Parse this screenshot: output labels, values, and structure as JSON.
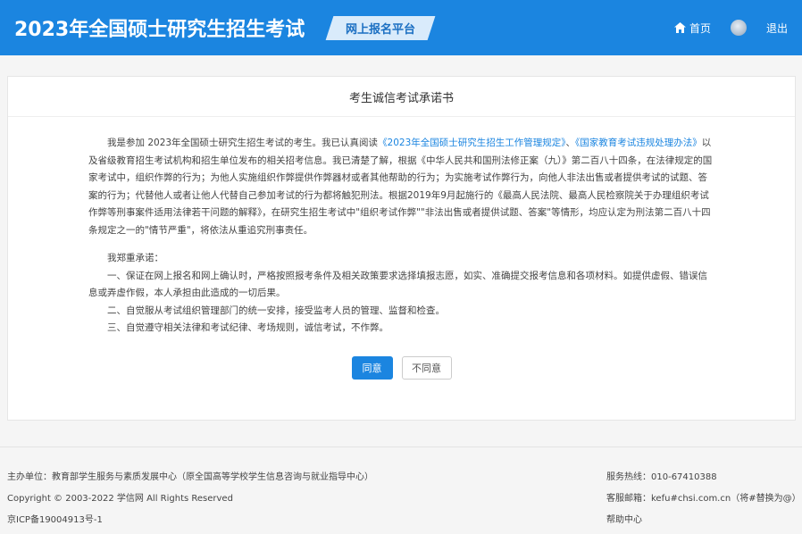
{
  "header": {
    "site_title": "2023年全国硕士研究生招生考试",
    "platform_badge": "网上报名平台",
    "home_label": "首页",
    "logout_label": "退出"
  },
  "card": {
    "title": "考生诚信考试承诺书",
    "para1_a": "我是参加 2023年全国硕士研究生招生考试的考生。我已认真阅读",
    "para1_link1": "《2023年全国硕士研究生招生工作管理规定》",
    "para1_sep": "、",
    "para1_link2": "《国家教育考试违规处理办法》",
    "para1_b": "以及省级教育招生考试机构和招生单位发布的相关招考信息。我已清楚了解，根据《中华人民共和国刑法修正案（九）》第二百八十四条，在法律规定的国家考试中，组织作弊的行为；为他人实施组织作弊提供作弊器材或者其他帮助的行为；为实施考试作弊行为，向他人非法出售或者提供考试的试题、答案的行为；代替他人或者让他人代替自己参加考试的行为都将触犯刑法。根据2019年9月起施行的《最高人民法院、最高人民检察院关于办理组织考试作弊等刑事案件适用法律若干问题的解释》，在研究生招生考试中\"组织考试作弊\"\"非法出售或者提供试题、答案\"等情形，均应认定为刑法第二百八十四条规定之一的\"情节严重\"，将依法从重追究刑事责任。",
    "pledge_intro": "我郑重承诺：",
    "pledge_1": "一、保证在网上报名和网上确认时，严格按照报考条件及相关政策要求选择填报志愿，如实、准确提交报考信息和各项材料。如提供虚假、错误信息或弄虚作假，本人承担由此造成的一切后果。",
    "pledge_2": "二、自觉服从考试组织管理部门的统一安排，接受监考人员的管理、监督和检查。",
    "pledge_3": "三、自觉遵守相关法律和考试纪律、考场规则，诚信考试，不作弊。",
    "agree_label": "同意",
    "disagree_label": "不同意"
  },
  "footer": {
    "sponsor": "主办单位：教育部学生服务与素质发展中心（原全国高等学校学生信息咨询与就业指导中心）",
    "copyright": "Copyright © 2003-2022 学信网 All Rights Reserved",
    "icp": "京ICP备19004913号-1",
    "hotline": "服务热线：010-67410388",
    "email": "客服邮箱：kefu#chsi.com.cn（将#替换为@）",
    "help": "帮助中心"
  },
  "colors": {
    "brand": "#1b85e0",
    "link": "#1b85e0"
  }
}
